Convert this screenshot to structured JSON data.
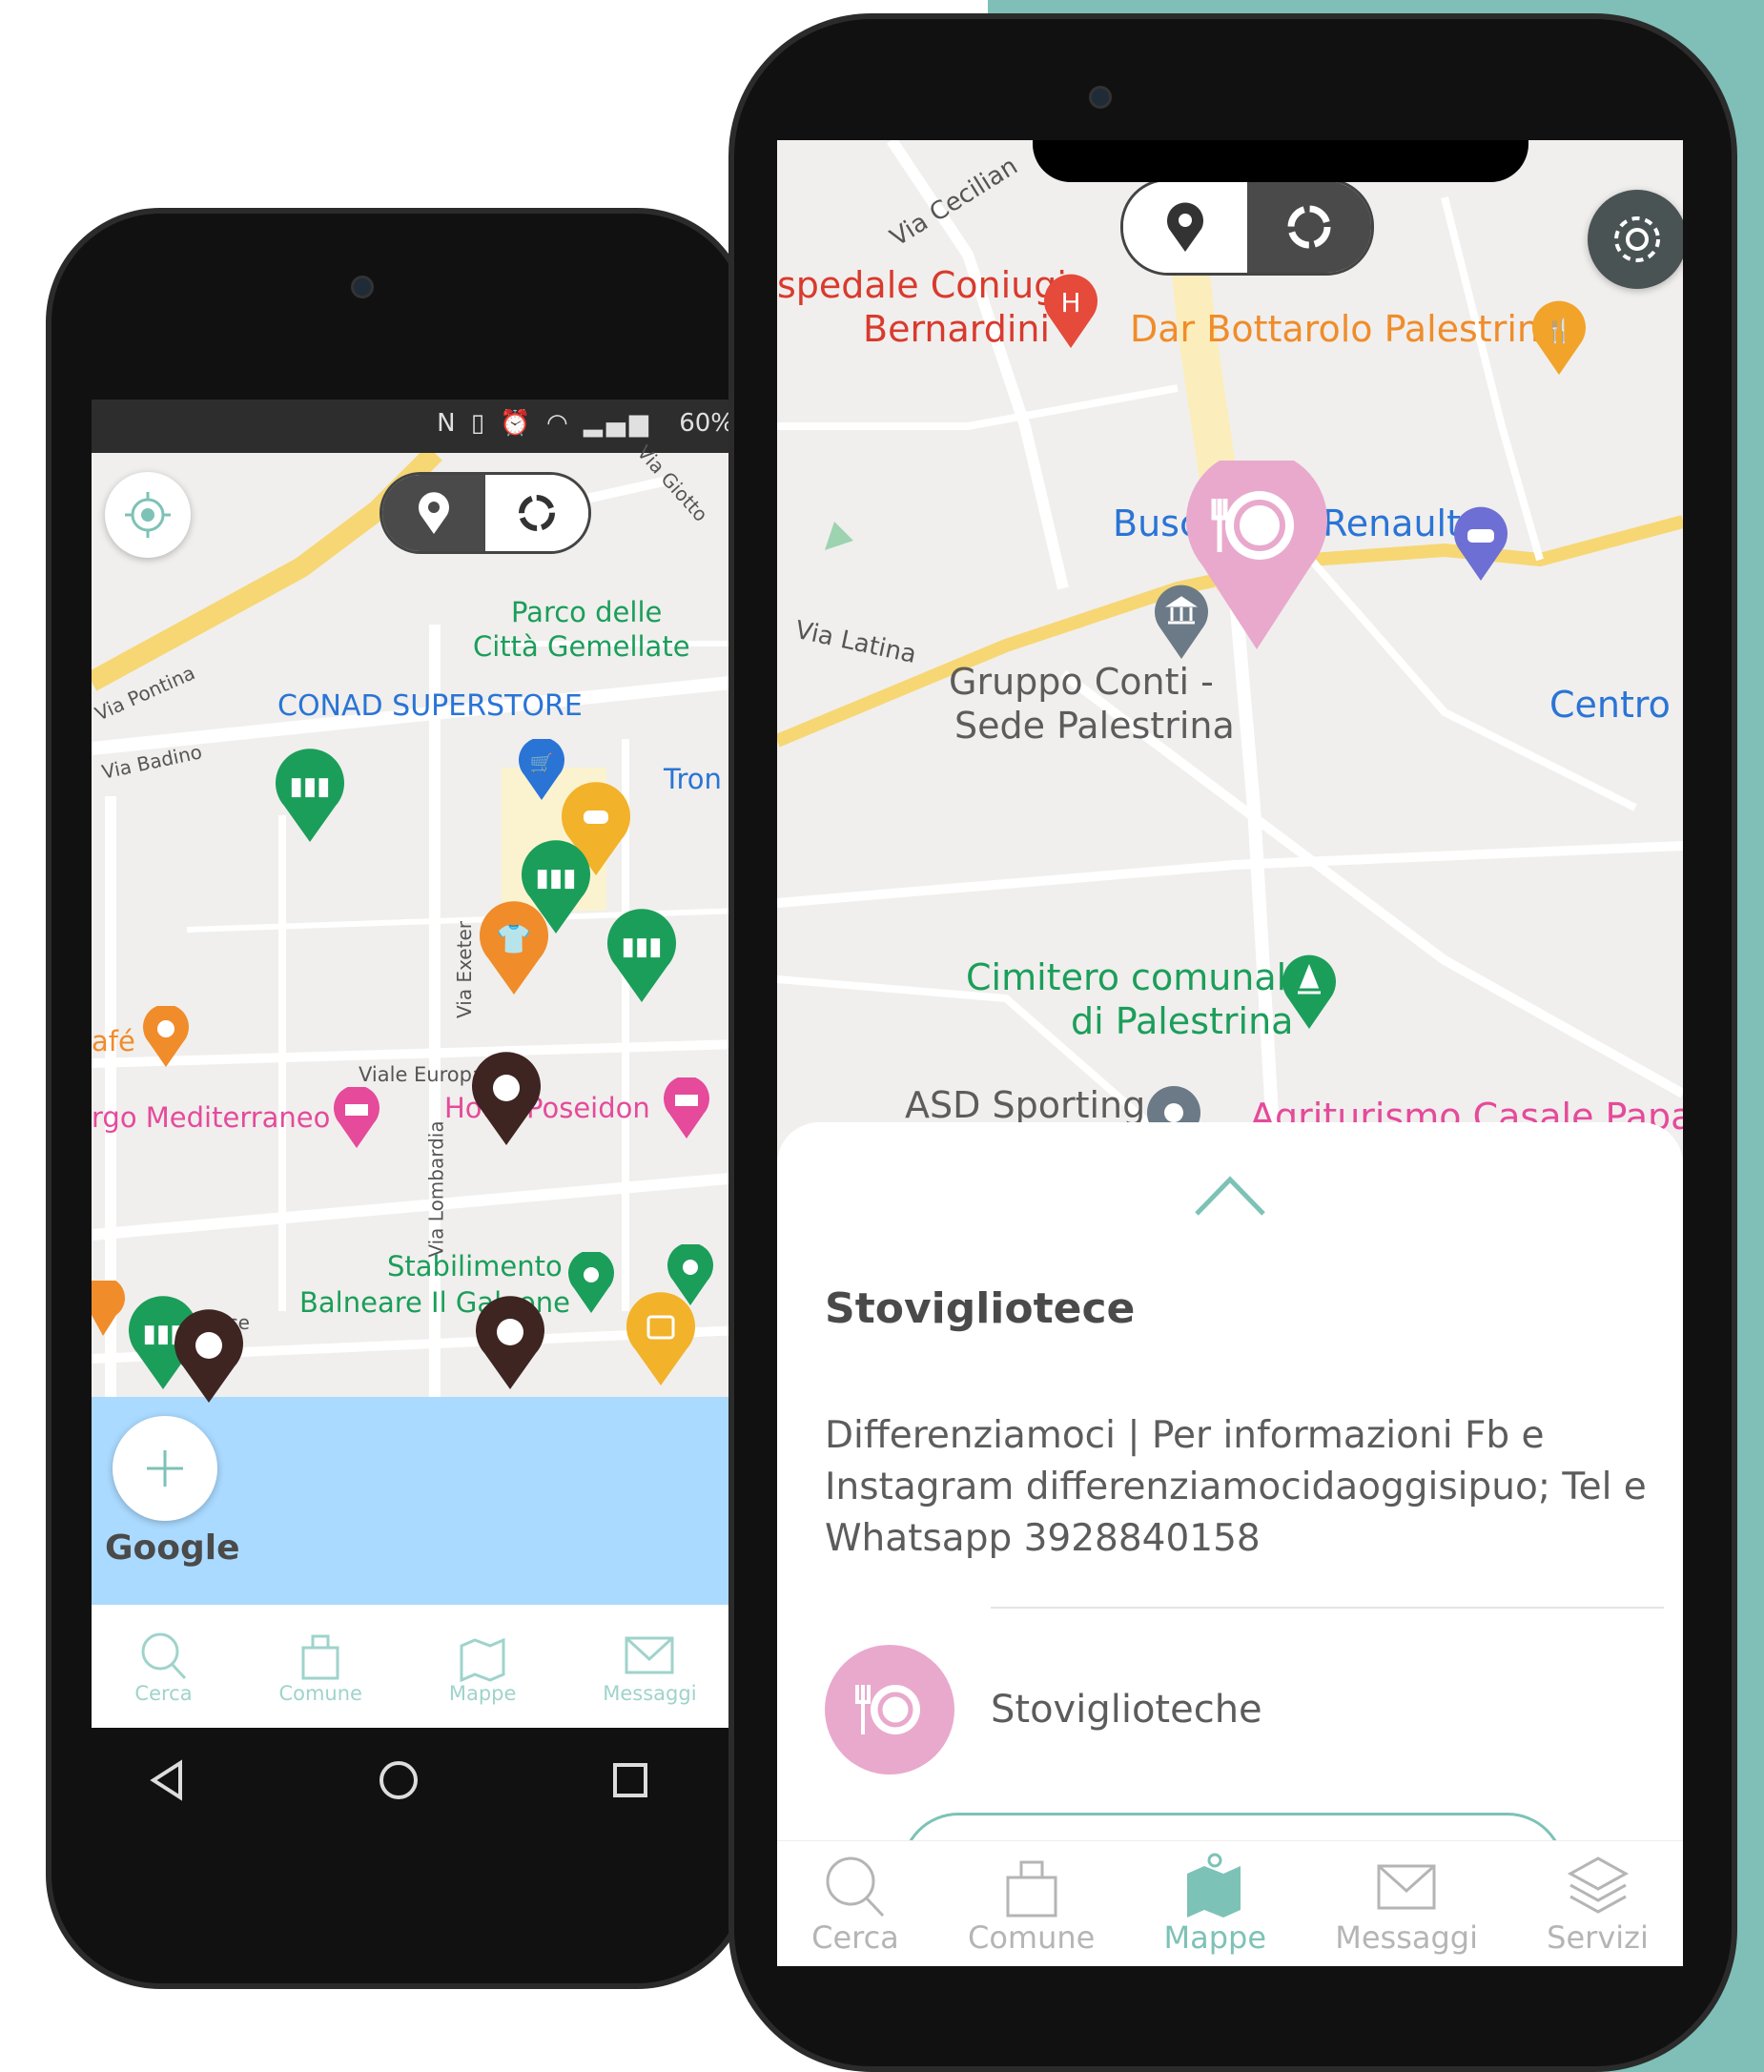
{
  "colors": {
    "teal_background": "#7fbfb7",
    "accent": "#7dc2b6",
    "pink": "#e9a9cc",
    "map_green": "#1b9e5a",
    "map_orange": "#f08c2a",
    "map_yellow": "#f2b22a",
    "map_brown": "#3e2522",
    "road_yellow": "#f7d774",
    "sea_blue": "#aadaff",
    "place_red": "#d93a2e",
    "place_blue": "#2a74d6",
    "place_pink": "#e54a9b",
    "gray_text": "#5c5c5c"
  },
  "left_phone": {
    "status_bar": {
      "battery": "60%",
      "icons": [
        "nfc-icon",
        "vibrate-icon",
        "alarm-icon",
        "wifi-icon",
        "signal-icon"
      ]
    },
    "map": {
      "labels": {
        "via_pontina": "Via Pontina",
        "via_giotto": "Via Giotto",
        "parco_line1": "Parco delle",
        "parco_line2": "Città Gemellate",
        "conad": "CONAD SUPERSTORE",
        "via_badino": "Via Badino",
        "tron": "Tron",
        "via_exeter": "Via Exeter",
        "cafe": "afé",
        "viale_europa": "Viale Europa",
        "mediterraneo": "rgo Mediterraneo",
        "poseidon": "Hotel Poseidon",
        "via_lombardia": "Via Lombardia",
        "stabilimento_line1": "Stabilimento",
        "stabilimento_line2": "Balneare Il Galeone",
        "viale_circe": "Viale Circe",
        "google": "Google"
      }
    },
    "fab_icon": "plus-icon",
    "locate_icon": "locate-icon",
    "tabs": [
      {
        "label": "Cerca",
        "icon": "search-icon"
      },
      {
        "label": "Comune",
        "icon": "building-icon"
      },
      {
        "label": "Mappe",
        "icon": "map-icon"
      },
      {
        "label": "Messaggi",
        "icon": "mail-icon"
      }
    ]
  },
  "right_phone": {
    "map": {
      "labels": {
        "via_cecilia": "Via Cecilian",
        "ospedale_line1": "spedale Coniugi",
        "ospedale_line2": "Bernardini",
        "bottarolo": "Dar Bottarolo Palestrina",
        "busc": "Busc",
        "renault": "Renault",
        "via_latina": "Via Latina",
        "gruppo_line1": "Gruppo Conti -",
        "gruppo_line2": "Sede Palestrina",
        "centro": "Centro c",
        "cimitero_line1": "Cimitero comunale",
        "cimitero_line2": "di Palestrina",
        "asd": "ASD Sporting",
        "agriturismo": "Agriturismo Casale Papa"
      }
    },
    "settings_icon": "gear-icon",
    "sheet": {
      "title": "Stovigliotece",
      "description": "Differenziamoci | Per informazioni Fb e Instagram differenziamocidaoggisipuo; Tel e Whatsapp 3928840158",
      "category_label": "Stoviglioteche",
      "chevron_icon": "chevron-up-icon"
    },
    "tabs": [
      {
        "label": "Cerca",
        "icon": "search-icon"
      },
      {
        "label": "Comune",
        "icon": "building-icon"
      },
      {
        "label": "Mappe",
        "icon": "map-icon"
      },
      {
        "label": "Messaggi",
        "icon": "mail-icon"
      },
      {
        "label": "Servizi",
        "icon": "layers-icon"
      }
    ]
  }
}
